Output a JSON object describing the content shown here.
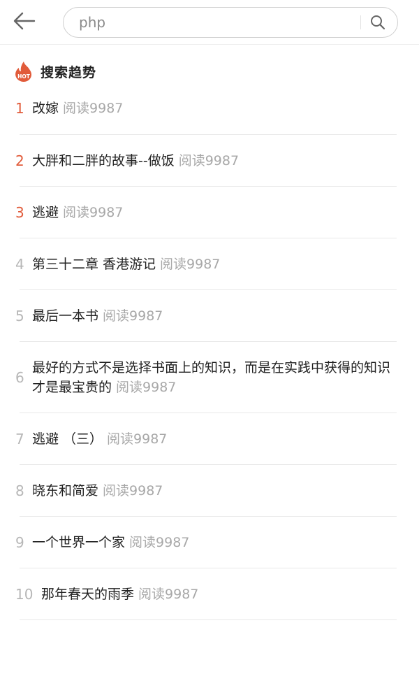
{
  "search": {
    "value": "php",
    "placeholder": ""
  },
  "section": {
    "title": "搜索趋势",
    "badge_text": "HOT",
    "accent": "#e15b3a"
  },
  "trends": [
    {
      "rank": "1",
      "title": "改嫁",
      "reads": "阅读9987"
    },
    {
      "rank": "2",
      "title": "大胖和二胖的故事--做饭",
      "reads": "阅读9987"
    },
    {
      "rank": "3",
      "title": "逃避",
      "reads": "阅读9987"
    },
    {
      "rank": "4",
      "title": "第三十二章 香港游记",
      "reads": "阅读9987"
    },
    {
      "rank": "5",
      "title": "最后一本书",
      "reads": "阅读9987"
    },
    {
      "rank": "6",
      "title": "最好的方式不是选择书面上的知识，而是在实践中获得的知识才是最宝贵的",
      "reads": "阅读9987"
    },
    {
      "rank": "7",
      "title": "逃避 （三）",
      "reads": "阅读9987"
    },
    {
      "rank": "8",
      "title": "晓东和简爱",
      "reads": "阅读9987"
    },
    {
      "rank": "9",
      "title": "一个世界一个家",
      "reads": "阅读9987"
    },
    {
      "rank": "10",
      "title": "那年春天的雨季",
      "reads": "阅读9987"
    }
  ]
}
